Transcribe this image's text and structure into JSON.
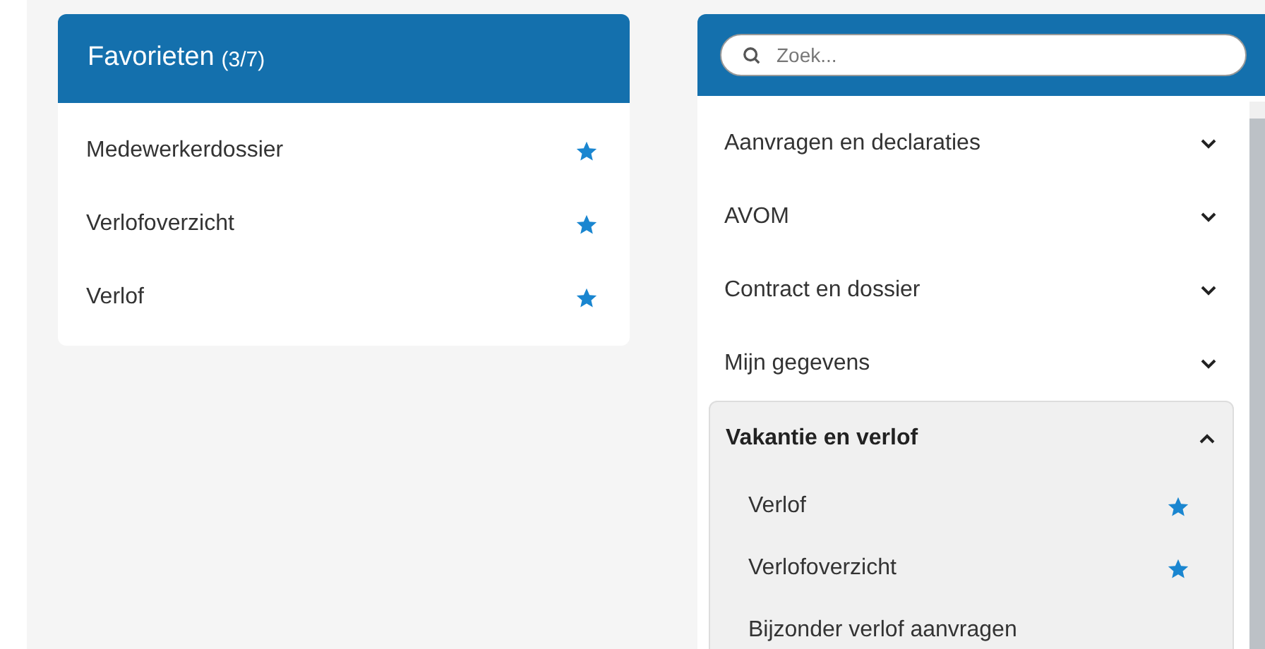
{
  "favorites": {
    "title": "Favorieten",
    "count": "(3/7)",
    "items": [
      {
        "label": "Medewerkerdossier",
        "starred": true
      },
      {
        "label": "Verlofoverzicht",
        "starred": true
      },
      {
        "label": "Verlof",
        "starred": true
      }
    ]
  },
  "menu": {
    "search": {
      "placeholder": "Zoek..."
    },
    "sections": [
      {
        "label": "Aanvragen en declaraties",
        "expanded": false
      },
      {
        "label": "AVOM",
        "expanded": false
      },
      {
        "label": "Contract en dossier",
        "expanded": false
      },
      {
        "label": "Mijn gegevens",
        "expanded": false
      },
      {
        "label": "Vakantie en verlof",
        "expanded": true,
        "children": [
          {
            "label": "Verlof",
            "starred": true
          },
          {
            "label": "Verlofoverzicht",
            "starred": true
          },
          {
            "label": "Bijzonder verlof aanvragen",
            "starred": false
          }
        ]
      }
    ]
  }
}
